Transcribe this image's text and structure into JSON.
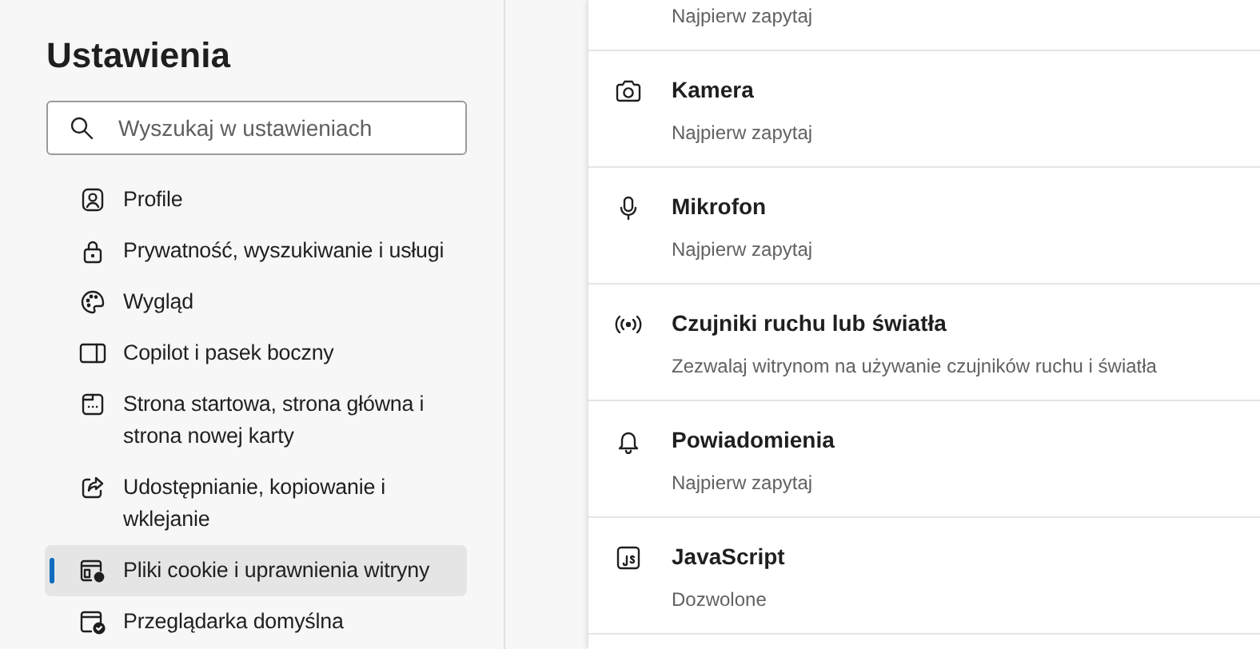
{
  "sidebar": {
    "title": "Ustawienia",
    "search": {
      "placeholder": "Wyszukaj w ustawieniach"
    },
    "items": [
      {
        "label": "Profile",
        "selected": false
      },
      {
        "label": "Prywatność, wyszukiwanie i usługi",
        "selected": false
      },
      {
        "label": "Wygląd",
        "selected": false
      },
      {
        "label": "Copilot i pasek boczny",
        "selected": false
      },
      {
        "label": "Strona startowa, strona główna i strona nowej karty",
        "selected": false
      },
      {
        "label": "Udostępnianie, kopiowanie i wklejanie",
        "selected": false
      },
      {
        "label": "Pliki cookie i uprawnienia witryny",
        "selected": true
      },
      {
        "label": "Przeglądarka domyślna",
        "selected": false
      }
    ]
  },
  "permissions": [
    {
      "subtitle": "Najpierw zapytaj"
    },
    {
      "title": "Kamera",
      "subtitle": "Najpierw zapytaj"
    },
    {
      "title": "Mikrofon",
      "subtitle": "Najpierw zapytaj"
    },
    {
      "title": "Czujniki ruchu lub światła",
      "subtitle": "Zezwalaj witrynom na używanie czujników ruchu i światła"
    },
    {
      "title": "Powiadomienia",
      "subtitle": "Najpierw zapytaj"
    },
    {
      "title": "JavaScript",
      "subtitle": "Dozwolone"
    }
  ]
}
